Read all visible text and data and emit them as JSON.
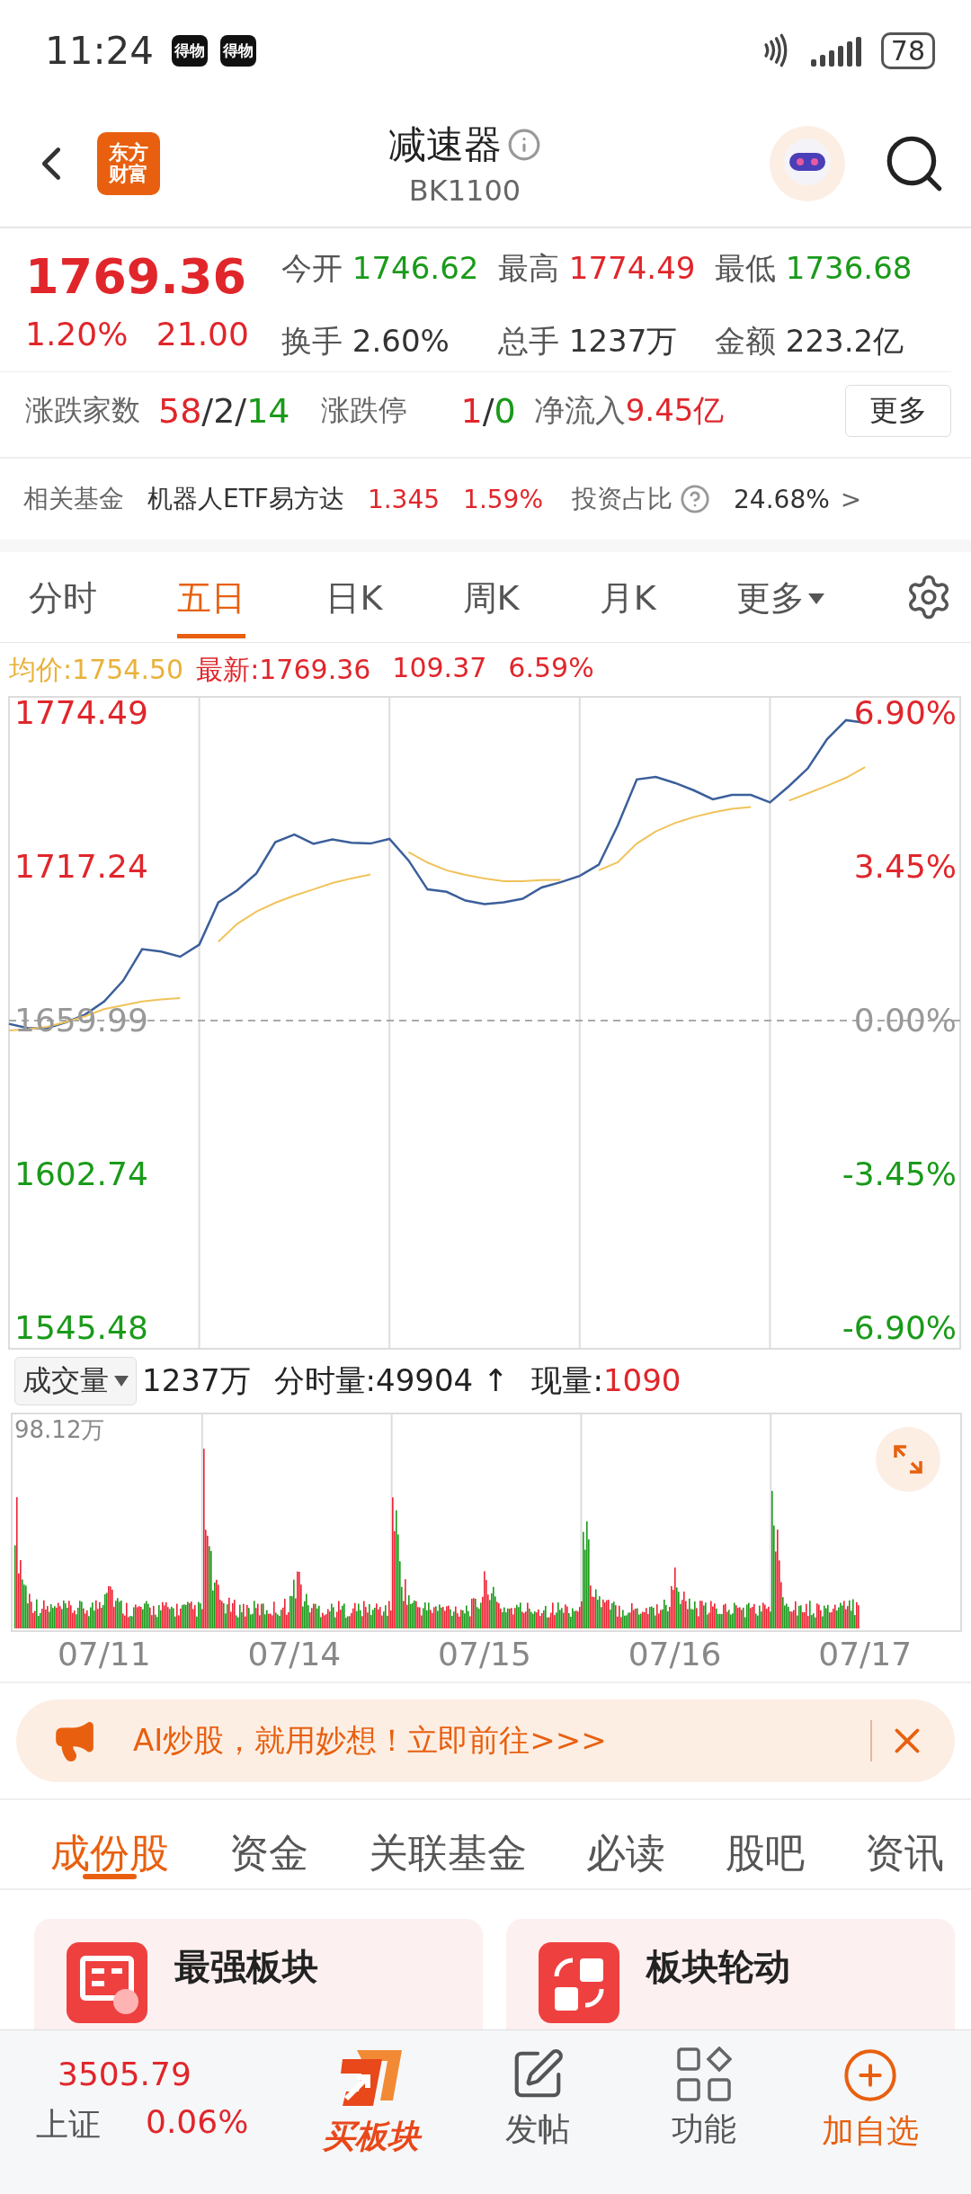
{
  "status_bar": {
    "time": "11:24",
    "app_badges": [
      "得物",
      "得物"
    ],
    "battery": "78"
  },
  "header": {
    "logo_lines": [
      "东方",
      "财富"
    ],
    "title": "减速器",
    "code": "BK1100"
  },
  "quote": {
    "price": "1769.36",
    "change_pct": "1.20%",
    "change": "21.00",
    "stats": [
      {
        "label": "今开",
        "value": "1746.62",
        "color": "#1a9a1a"
      },
      {
        "label": "最高",
        "value": "1774.49",
        "color": "#e0262b"
      },
      {
        "label": "最低",
        "value": "1736.68",
        "color": "#1a9a1a"
      },
      {
        "label": "换手",
        "value": "2.60%",
        "color": "#333333"
      },
      {
        "label": "总手",
        "value": "1237万",
        "color": "#333333"
      },
      {
        "label": "金额",
        "value": "223.2亿",
        "color": "#333333"
      }
    ],
    "breadth": {
      "label": "涨跌家数",
      "up": "58",
      "flat": "2",
      "down": "14",
      "separator": "/"
    },
    "limit": {
      "label": "涨跌停",
      "up": "1",
      "down": "0",
      "separator": "/"
    },
    "net_inflow": {
      "label": "净流入",
      "value": "9.45亿"
    },
    "more_button": "更多"
  },
  "related_fund": {
    "label": "相关基金",
    "name": "机器人ETF易方达",
    "price": "1.345",
    "change": "1.59%",
    "share_label": "投资占比",
    "share": "24.68%",
    "arrow": ">"
  },
  "chart_tabs": [
    {
      "label": "分时",
      "selected": false
    },
    {
      "label": "五日",
      "selected": true
    },
    {
      "label": "日K",
      "selected": false
    },
    {
      "label": "周K",
      "selected": false
    },
    {
      "label": "月K",
      "selected": false
    },
    {
      "label": "更多",
      "selected": false,
      "kind": "dropdown"
    }
  ],
  "price_chart": {
    "avg_label": "均价:",
    "avg": "1754.50",
    "latest_label": "最新:",
    "latest": "1769.36",
    "change": "109.37",
    "change_pct": "6.59%",
    "percent_labels": [
      "6.90%",
      "3.45%",
      "0.00%",
      "-3.45%",
      "-6.90%"
    ],
    "chart_data": {
      "type": "line",
      "ylim": [
        1538,
        1781
      ],
      "grid": true,
      "ref_lines": [
        {
          "axis": "y",
          "value": 1659.99
        }
      ],
      "yticks": [
        {
          "value": 1774.49,
          "label": "1774.49"
        },
        {
          "value": 1717.24,
          "label": "1717.24"
        },
        {
          "value": 1659.99,
          "label": "1659.99"
        },
        {
          "value": 1602.74,
          "label": "1602.74"
        },
        {
          "value": 1545.48,
          "label": "1545.48"
        }
      ],
      "categories": [
        null,
        null,
        null,
        null,
        null,
        null,
        null,
        null,
        null,
        null,
        null,
        null,
        null,
        null,
        null,
        null,
        null,
        null,
        null,
        null,
        null,
        null,
        null,
        null,
        null,
        null,
        null,
        null,
        null,
        null,
        null,
        null,
        null,
        null,
        null,
        null,
        null,
        null,
        null,
        null,
        null,
        null,
        null,
        null,
        null,
        null,
        null,
        null,
        null,
        null
      ],
      "series": [
        {
          "color": "#3b5f9a",
          "values": [
            1658.8,
            1657.2,
            1657.2,
            1659.4,
            1662.2,
            1667.1,
            1674.9,
            1686.6,
            1685.7,
            1683.8,
            1688.3,
            1704.0,
            1708.6,
            1714.8,
            1726.5,
            1729.3,
            1725.9,
            1727.5,
            1726.3,
            1726.0,
            1727.7,
            1719.7,
            1708.9,
            1708.0,
            1704.7,
            1703.4,
            1704.1,
            1705.4,
            1709.6,
            1711.6,
            1713.9,
            1718.1,
            1732.7,
            1749.9,
            1750.8,
            1748.6,
            1745.8,
            1742.5,
            1744.1,
            1744.1,
            1741.3,
            1747.4,
            1754.1,
            1764.9,
            1772.0,
            1771.0,
            null,
            null,
            null,
            null
          ]
        },
        {
          "color": "#f0c35a",
          "values": [
            1656.3,
            1656.8,
            1657.7,
            1659.5,
            1661.6,
            1664.3,
            1665.7,
            1667.1,
            1667.9,
            1668.4,
            null,
            1689.4,
            1696.1,
            1700.6,
            1703.9,
            1706.6,
            1708.9,
            1711.3,
            1713.0,
            1714.5,
            null,
            1722.8,
            1718.9,
            1716.0,
            1714.3,
            1713.0,
            1712.0,
            1712.0,
            1712.4,
            1712.5,
            null,
            1716.0,
            1719.0,
            1726.0,
            1730.5,
            1733.6,
            1735.9,
            1737.6,
            1738.9,
            1739.6,
            null,
            1742.0,
            1744.7,
            1747.5,
            1750.5,
            1754.5,
            null,
            null,
            null,
            null
          ]
        }
      ]
    }
  },
  "volume": {
    "selector": "成交量",
    "total": "1237万",
    "tick_label": "分时量:",
    "tick": "49904",
    "arrow": "↑",
    "current_label": "现量:",
    "current": "1090",
    "max_label": "98.12万",
    "dates": [
      "07/11",
      "07/14",
      "07/15",
      "07/16",
      "07/17"
    ]
  },
  "banner": {
    "text": "AI炒股，就用妙想！立即前往>>>"
  },
  "section_tabs": [
    {
      "label": "成份股",
      "selected": true
    },
    {
      "label": "资金",
      "selected": false
    },
    {
      "label": "关联基金",
      "selected": false
    },
    {
      "label": "必读",
      "selected": false
    },
    {
      "label": "股吧",
      "selected": false
    },
    {
      "label": "资讯",
      "selected": false
    }
  ],
  "cards": [
    {
      "title": "最强板块",
      "kind": "board"
    },
    {
      "title": "板块轮动",
      "kind": "rotate"
    }
  ],
  "bottom_bar": {
    "index_value": "3505.79",
    "index_name": "上证",
    "index_change": "0.06%",
    "items": [
      {
        "label": "买板块",
        "kind": "brand"
      },
      {
        "label": "发帖",
        "kind": "post"
      },
      {
        "label": "功能",
        "kind": "apps"
      },
      {
        "label": "加自选",
        "kind": "add"
      }
    ]
  }
}
